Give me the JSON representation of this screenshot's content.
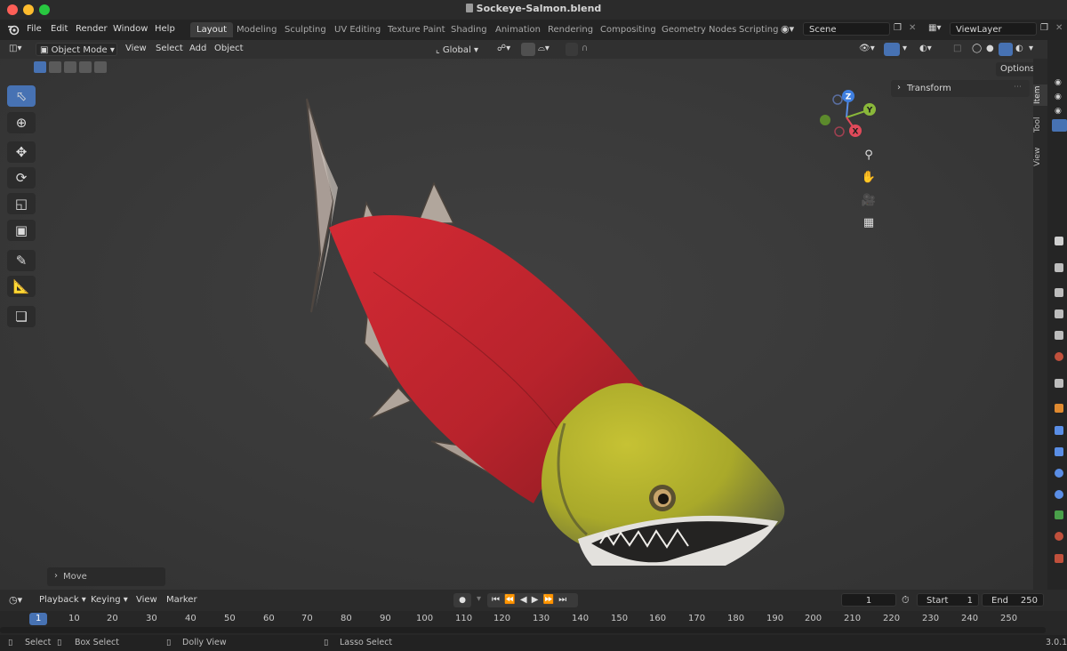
{
  "window": {
    "title": "Sockeye-Salmon.blend"
  },
  "menu": [
    "File",
    "Edit",
    "Render",
    "Window",
    "Help"
  ],
  "workspaces": [
    "Layout",
    "Modeling",
    "Sculpting",
    "UV Editing",
    "Texture Paint",
    "Shading",
    "Animation",
    "Rendering",
    "Compositing",
    "Geometry Nodes",
    "Scripting"
  ],
  "scene": {
    "name": "Scene",
    "view_layer": "ViewLayer"
  },
  "viewport_header": {
    "mode": "Object Mode",
    "view": "View",
    "select": "Select",
    "add": "Add",
    "object": "Object",
    "orientation": "Global",
    "options": "Options"
  },
  "toolbar_icons": [
    "select-box-icon",
    "cursor-icon",
    "move-icon",
    "rotate-icon",
    "scale-icon",
    "transform-icon",
    "annotate-icon",
    "measure-icon",
    "add-cube-icon"
  ],
  "gizmo": {
    "z": "Z",
    "y": "Y",
    "x": "X"
  },
  "sidebar": {
    "panel": "Transform",
    "tabs": [
      "Item",
      "Tool",
      "View"
    ]
  },
  "operator_panel": {
    "label": "Move"
  },
  "timeline": {
    "menus": [
      "Playback",
      "Keying",
      "View",
      "Marker"
    ],
    "current_frame": "1",
    "start_label": "Start",
    "start": "1",
    "end_label": "End",
    "end": "250",
    "ruler": [
      "1",
      "10",
      "20",
      "30",
      "40",
      "50",
      "60",
      "70",
      "80",
      "90",
      "100",
      "110",
      "120",
      "130",
      "140",
      "150",
      "160",
      "170",
      "180",
      "190",
      "200",
      "210",
      "220",
      "230",
      "240",
      "250"
    ]
  },
  "statusbar": {
    "select": "Select",
    "box_select": "Box Select",
    "dolly_view": "Dolly View",
    "lasso_select": "Lasso Select",
    "version": "3.0.1"
  },
  "colors": {
    "accent": "#4772b3",
    "salmon_body": "#b8232c",
    "salmon_head": "#a9a92a",
    "viewport_bg": "#393939"
  }
}
